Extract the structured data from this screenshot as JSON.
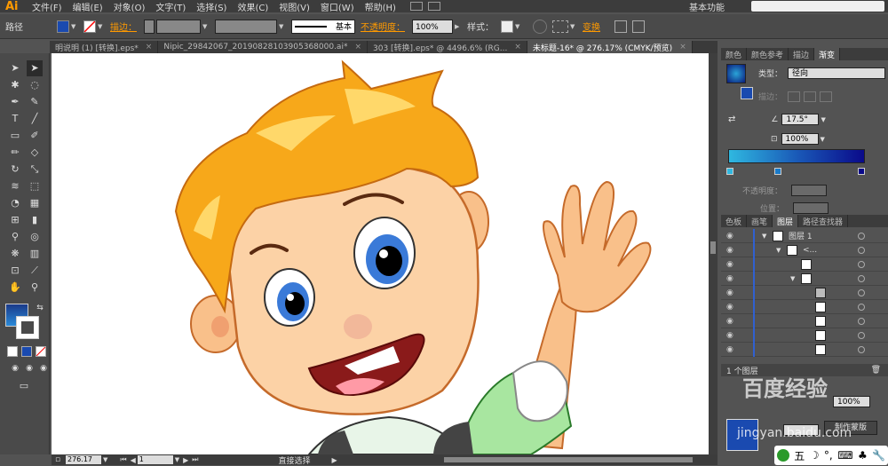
{
  "app": {
    "logo": "Ai"
  },
  "menu": [
    "文件(F)",
    "编辑(E)",
    "对象(O)",
    "文字(T)",
    "选择(S)",
    "效果(C)",
    "视图(V)",
    "窗口(W)",
    "帮助(H)"
  ],
  "workspace": "基本功能",
  "control_bar": {
    "object_type": "路径",
    "stroke_label": "描边：",
    "stroke_style": "基本",
    "opacity_label": "不透明度：",
    "opacity_value": "100%",
    "style_label": "样式：",
    "transform_label": "变换",
    "colors": {
      "fill": "#1a4ab0",
      "accent": "#ff9a00"
    }
  },
  "doc_tabs": [
    {
      "label": "明说明 (1) [转换].eps*",
      "active": false
    },
    {
      "label": "Nipic_29842067_20190828103905368000.ai*",
      "active": false
    },
    {
      "label": "303 [转换].eps* @ 4496.6% (RG...",
      "active": false
    },
    {
      "label": "未标题-16* @ 276.17% (CMYK/预览)",
      "active": true
    }
  ],
  "tools": [
    "selection-tool",
    "direct-selection-tool",
    "magic-wand-tool",
    "lasso-tool",
    "pen-tool",
    "curvature-tool",
    "type-tool",
    "line-tool",
    "rectangle-tool",
    "paintbrush-tool",
    "pencil-tool",
    "eraser-tool",
    "rotate-tool",
    "scale-tool",
    "width-tool",
    "free-transform-tool",
    "shape-builder-tool",
    "perspective-grid-tool",
    "mesh-tool",
    "gradient-tool",
    "eyedropper-tool",
    "blend-tool",
    "symbol-sprayer-tool",
    "column-graph-tool",
    "artboard-tool",
    "slice-tool",
    "hand-tool",
    "zoom-tool"
  ],
  "status_bar": {
    "zoom": "276.17",
    "artboard": "1",
    "status": "直接选择"
  },
  "gradient_panel": {
    "tabs": [
      {
        "label": "颜色",
        "active": false
      },
      {
        "label": "颜色参考",
        "active": false
      },
      {
        "label": "描边",
        "active": false
      },
      {
        "label": "渐变",
        "active": true
      }
    ],
    "type_label": "类型：",
    "type_value": "径向",
    "stroke_label": "描边：",
    "angle_value": "17.5°",
    "ratio_value": "100%",
    "opacity_label": "不透明度：",
    "location_label": "位置："
  },
  "layers_panel": {
    "tabs": [
      {
        "label": "色板",
        "active": false
      },
      {
        "label": "画笔",
        "active": false
      },
      {
        "label": "图层",
        "active": true
      },
      {
        "label": "路径查找器",
        "active": false
      }
    ],
    "rows": [
      {
        "name": "图层 1",
        "indent": 0
      },
      {
        "name": "<...",
        "indent": 1
      },
      {
        "name": "",
        "indent": 2
      },
      {
        "name": "",
        "indent": 2
      },
      {
        "name": "",
        "indent": 3
      },
      {
        "name": "",
        "indent": 3
      },
      {
        "name": "",
        "indent": 3
      },
      {
        "name": "",
        "indent": 3
      },
      {
        "name": "",
        "indent": 3
      }
    ],
    "footer": "1 个图层"
  },
  "transparency_panel": {
    "opacity_value": "100%",
    "mask_button": "制作蒙版"
  },
  "watermark": {
    "main": "百度经验",
    "sub": "jingyan.baidu.com"
  },
  "ime": {
    "label": "五"
  }
}
